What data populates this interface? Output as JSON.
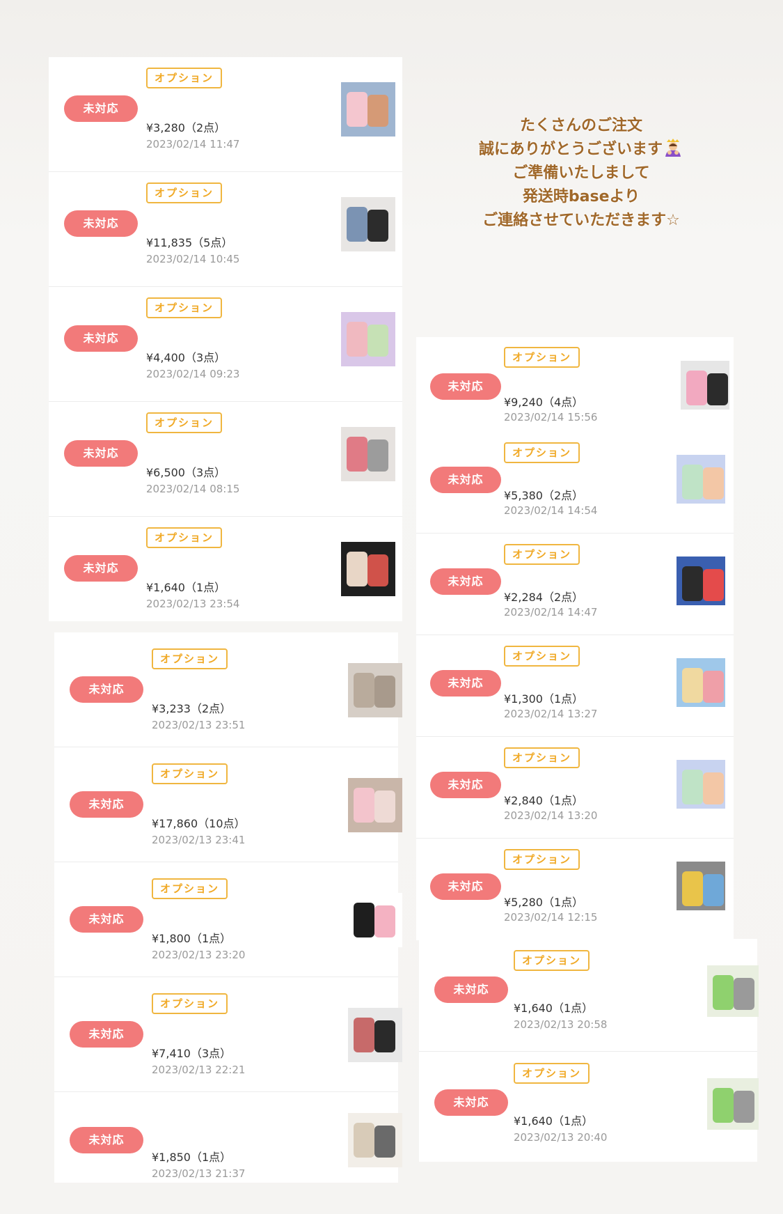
{
  "message": {
    "lines": [
      "たくさんのご注文",
      "誠にありがとうございます",
      "ご準備いたしまして",
      "発送時baseより",
      "ご連絡させていただきます☆"
    ],
    "emoji_icon": "person-bowing-icon"
  },
  "colors": {
    "badge": "#f27a7a",
    "tag_border": "#f0b640",
    "tag_text": "#f0a926",
    "message_text": "#a0682a"
  },
  "common": {
    "status_label": "未対応",
    "option_label": "オプション"
  },
  "left_orders_a": [
    {
      "price": "¥3,280（2点）",
      "date": "2023/02/14 11:47",
      "thumb_icon": "baby-clothes-thumbnail",
      "thumb_colors": [
        "#f4c6cf",
        "#d59a76",
        "#9fb5d0"
      ]
    },
    {
      "price": "¥11,835（5点）",
      "date": "2023/02/14 10:45",
      "thumb_icon": "pants-thumbnail",
      "thumb_colors": [
        "#7b93b3",
        "#2c2c2c",
        "#e8e6e4"
      ]
    },
    {
      "price": "¥4,400（3点）",
      "date": "2023/02/14 09:23",
      "thumb_icon": "tshirts-thumbnail",
      "thumb_colors": [
        "#f0b9c0",
        "#c6e1b5",
        "#d9c7e8"
      ]
    },
    {
      "price": "¥6,500（3点）",
      "date": "2023/02/14 08:15",
      "thumb_icon": "jacket-thumbnail",
      "thumb_colors": [
        "#e07b86",
        "#9c9c9c",
        "#e6e2df"
      ]
    },
    {
      "price": "¥1,640（1点）",
      "date": "2023/02/13 23:54",
      "thumb_icon": "sweatshirts-thumbnail",
      "thumb_colors": [
        "#e8d6c6",
        "#d0524a",
        "#1f1f1f"
      ]
    }
  ],
  "left_orders_b": [
    {
      "price": "¥3,233（2点）",
      "date": "2023/02/13 23:51",
      "thumb_icon": "knit-thumbnail",
      "thumb_colors": [
        "#b9ab9c",
        "#a89a8c",
        "#d6cec6"
      ]
    },
    {
      "price": "¥17,860（10点）",
      "date": "2023/02/13 23:41",
      "thumb_icon": "pink-top-thumbnail",
      "thumb_colors": [
        "#f3c4cc",
        "#eedad5",
        "#c9b6a9"
      ]
    },
    {
      "price": "¥1,800（1点）",
      "date": "2023/02/13 23:20",
      "thumb_icon": "character-tops-thumbnail",
      "thumb_colors": [
        "#1e1e1e",
        "#f4b2c2",
        "#ffffff"
      ]
    },
    {
      "price": "¥7,410（3点）",
      "date": "2023/02/13 22:21",
      "thumb_icon": "checker-blanket-thumbnail",
      "thumb_colors": [
        "#c76a6a",
        "#2a2a2a",
        "#e8e8e8"
      ]
    },
    {
      "price": "¥1,850（1点）",
      "date": "2023/02/13 21:37",
      "thumb_icon": "socks-thumbnail",
      "thumb_colors": [
        "#d8cbb8",
        "#6a6a6a",
        "#f2eee8"
      ]
    }
  ],
  "right_top_order": {
    "price": "¥9,240（4点）",
    "date": "2023/02/14 15:56",
    "thumb_icon": "pink-pants-thumbnail",
    "thumb_colors": [
      "#f2a9c0",
      "#2b2b2b",
      "#e6e6e6"
    ]
  },
  "right_orders": [
    {
      "price": "¥5,380（2点）",
      "date": "2023/02/14 14:54",
      "thumb_icon": "pastel-set-thumbnail",
      "thumb_colors": [
        "#bfe3c6",
        "#f3c7a6",
        "#c8d3f0"
      ]
    },
    {
      "price": "¥2,284（2点）",
      "date": "2023/02/14 14:47",
      "thumb_icon": "raglan-tees-thumbnail",
      "thumb_colors": [
        "#2b2b2b",
        "#e44b4b",
        "#3a5fb0"
      ]
    },
    {
      "price": "¥1,300（1点）",
      "date": "2023/02/14 13:27",
      "thumb_icon": "print-tees-thumbnail",
      "thumb_colors": [
        "#f0d9a0",
        "#ef9fa8",
        "#9fc8ea"
      ]
    },
    {
      "price": "¥2,840（1点）",
      "date": "2023/02/14 13:20",
      "thumb_icon": "pastel-set-thumbnail",
      "thumb_colors": [
        "#bfe3c6",
        "#f3c7a6",
        "#c8d3f0"
      ]
    },
    {
      "price": "¥5,280（1点）",
      "date": "2023/02/14 12:15",
      "thumb_icon": "hoodies-thumbnail",
      "thumb_colors": [
        "#e9c44a",
        "#6fa8d8",
        "#8a8a8a"
      ]
    }
  ],
  "right_orders_bottom": [
    {
      "price": "¥1,640（1点）",
      "date": "2023/02/13 20:58",
      "thumb_icon": "dino-set-thumbnail",
      "thumb_colors": [
        "#8fd16e",
        "#9a9a9a",
        "#e9efe0"
      ]
    },
    {
      "price": "¥1,640（1点）",
      "date": "2023/02/13 20:40",
      "thumb_icon": "dino-set-thumbnail",
      "thumb_colors": [
        "#8fd16e",
        "#9a9a9a",
        "#e9efe0"
      ]
    }
  ]
}
